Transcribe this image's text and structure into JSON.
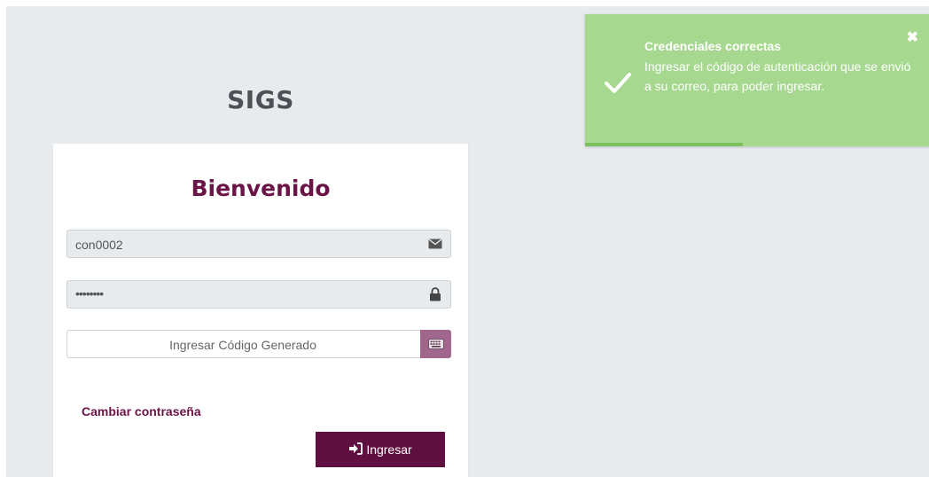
{
  "app": {
    "title": "SIGS"
  },
  "login": {
    "welcome": "Bienvenido",
    "username_value": "con0002",
    "password_value": "••••••••",
    "code_placeholder": "Ingresar Código Generado",
    "change_password_link": "Cambiar contraseña",
    "submit_label": "Ingresar",
    "icons": [
      "envelope-icon",
      "lock-icon",
      "keyboard-icon",
      "sign-in-icon"
    ]
  },
  "toast": {
    "title": "Credenciales correctas",
    "message": "Ingresar el código de autenticación que se envió a su correo, para poder ingresar.",
    "progress": 0.46,
    "colors": {
      "background": "#a6d98f",
      "progress": "#7cbf5e"
    }
  },
  "colors": {
    "accent": "#6b1447",
    "button": "#5f1040",
    "addon": "#a0668c"
  }
}
